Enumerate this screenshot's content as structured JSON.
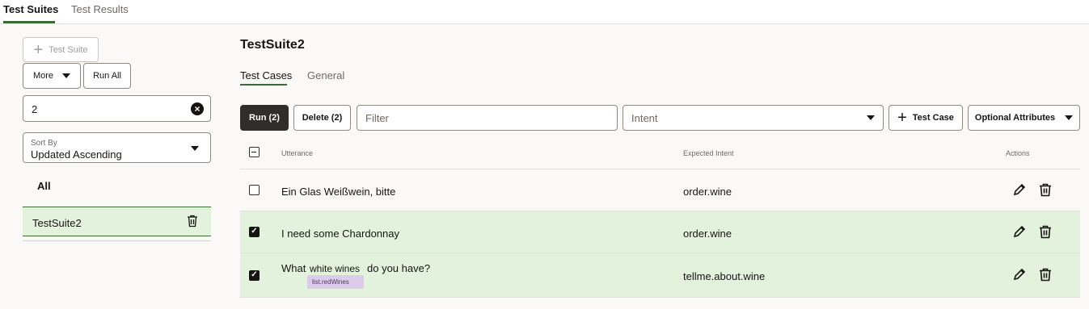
{
  "top_tabs": [
    {
      "label": "Test Suites",
      "active": true
    },
    {
      "label": "Test Results",
      "active": false
    }
  ],
  "left_panel": {
    "add_suite_label": "Test Suite",
    "more_label": "More",
    "run_all_label": "Run All",
    "search_value": "2",
    "sort": {
      "label": "Sort By",
      "value": "Updated Ascending"
    },
    "all_label": "All",
    "suites": [
      {
        "name": "TestSuite2",
        "selected": true
      }
    ]
  },
  "main": {
    "suite_title": "TestSuite2",
    "tabs": [
      {
        "label": "Test Cases",
        "active": true
      },
      {
        "label": "General",
        "active": false
      }
    ],
    "toolbar": {
      "run_label": "Run (2)",
      "delete_label": "Delete (2)",
      "filter_placeholder": "Filter",
      "intent_placeholder": "Intent",
      "add_case_label": "Test Case",
      "optional_attributes_label": "Optional Attributes"
    },
    "columns": {
      "utterance": "Utterance",
      "expected_intent": "Expected Intent",
      "actions": "Actions"
    },
    "rows": [
      {
        "checked": false,
        "utterance": "Ein Glas Weißwein, bitte",
        "intent": "order.wine"
      },
      {
        "checked": true,
        "utterance": "I need some Chardonnay",
        "intent": "order.wine"
      },
      {
        "checked": true,
        "utterance_parts": {
          "before": "What",
          "entity": "white wines",
          "after": "do you have?",
          "entity_tag": "list.redWines"
        },
        "intent": "tellme.about.wine"
      }
    ]
  },
  "colors": {
    "accent_green": "#3a6b35",
    "selected_row": "#e2f2dc",
    "dark_button": "#312d2a",
    "entity_tag": "#dccbea"
  }
}
